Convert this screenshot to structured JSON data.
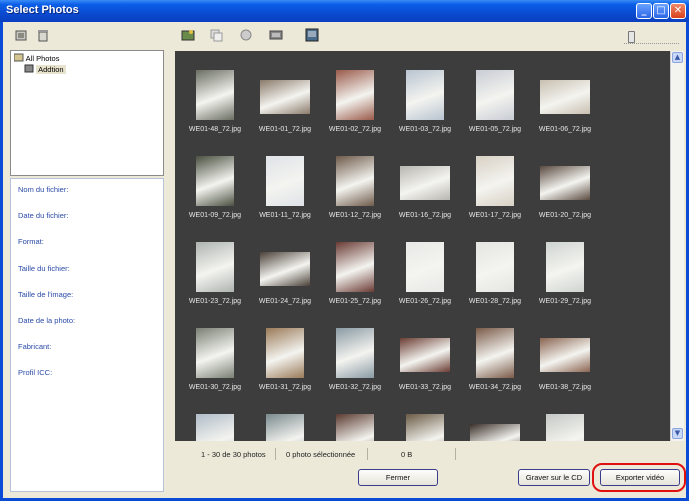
{
  "window": {
    "title": "Select Photos",
    "controls": [
      "_",
      "□",
      "✕"
    ]
  },
  "left_toolbar": {
    "icons": [
      "import-icon",
      "trash-icon"
    ]
  },
  "tree": {
    "root_label": "All Photos",
    "child_label": "Addtion"
  },
  "properties": [
    "Nom du fichier:",
    "Date du fichier:",
    "Format:",
    "Taille du fichier:",
    "Taille de l'image:",
    "Date de la photo:",
    "Fabricant:",
    "Profil ICC:"
  ],
  "right_toolbar": {
    "icons": [
      "add-photo-icon",
      "copy-icon",
      "rotate-icon",
      "view-icon",
      "export-icon"
    ],
    "zoom_slider_level": 0.05
  },
  "photos": [
    {
      "name": "WE01-48_72.jpg",
      "bg": "#6a6e62"
    },
    {
      "name": "WE01-01_72.jpg",
      "bg": "#8a7a6a"
    },
    {
      "name": "WE01-02_72.jpg",
      "bg": "#9a5a4a"
    },
    {
      "name": "WE01-03_72.jpg",
      "bg": "#b8c4d0"
    },
    {
      "name": "WE01-05_72.jpg",
      "bg": "#c8ccd4"
    },
    {
      "name": "WE01-06_72.jpg",
      "bg": "#c8bfb0"
    },
    {
      "name": "WE01-09_72.jpg",
      "bg": "#4a5040"
    },
    {
      "name": "WE01-11_72.jpg",
      "bg": "#dfe3e8"
    },
    {
      "name": "WE01-12_72.jpg",
      "bg": "#6e5a4a"
    },
    {
      "name": "WE01-16_72.jpg",
      "bg": "#b8b6b0"
    },
    {
      "name": "WE01-17_72.jpg",
      "bg": "#d8d0c4"
    },
    {
      "name": "WE01-20_72.jpg",
      "bg": "#5a4a40"
    },
    {
      "name": "WE01-23_72.jpg",
      "bg": "#aeb4b0"
    },
    {
      "name": "WE01-24_72.jpg",
      "bg": "#4a4038"
    },
    {
      "name": "WE01-25_72.jpg",
      "bg": "#6a3a34"
    },
    {
      "name": "WE01-26_72.jpg",
      "bg": "#e8e8e6"
    },
    {
      "name": "WE01-28_72.jpg",
      "bg": "#e4e4e0"
    },
    {
      "name": "WE01-29_72.jpg",
      "bg": "#cfd4d0"
    },
    {
      "name": "WE01-30_72.jpg",
      "bg": "#7a8074"
    },
    {
      "name": "WE01-31_72.jpg",
      "bg": "#9a7a58"
    },
    {
      "name": "WE01-32_72.jpg",
      "bg": "#8a9aa4"
    },
    {
      "name": "WE01-33_72.jpg",
      "bg": "#6a3c32"
    },
    {
      "name": "WE01-34_72.jpg",
      "bg": "#7a5a48"
    },
    {
      "name": "WE01-38_72.jpg",
      "bg": "#8a6450"
    },
    {
      "name": "",
      "bg": "#b0bcc8"
    },
    {
      "name": "",
      "bg": "#7a8a8e"
    },
    {
      "name": "",
      "bg": "#5a3a30"
    },
    {
      "name": "",
      "bg": "#6a5a44"
    },
    {
      "name": "",
      "bg": "#3a2e28"
    },
    {
      "name": "",
      "bg": "#c4c8c4"
    }
  ],
  "status": {
    "range": "1 - 30 de 30 photos",
    "selected": "0 photo sélectionnée",
    "size": "0 B"
  },
  "buttons": {
    "close": "Fermer",
    "burn_cd": "Graver sur le CD",
    "export_video": "Exporter vidéo"
  }
}
